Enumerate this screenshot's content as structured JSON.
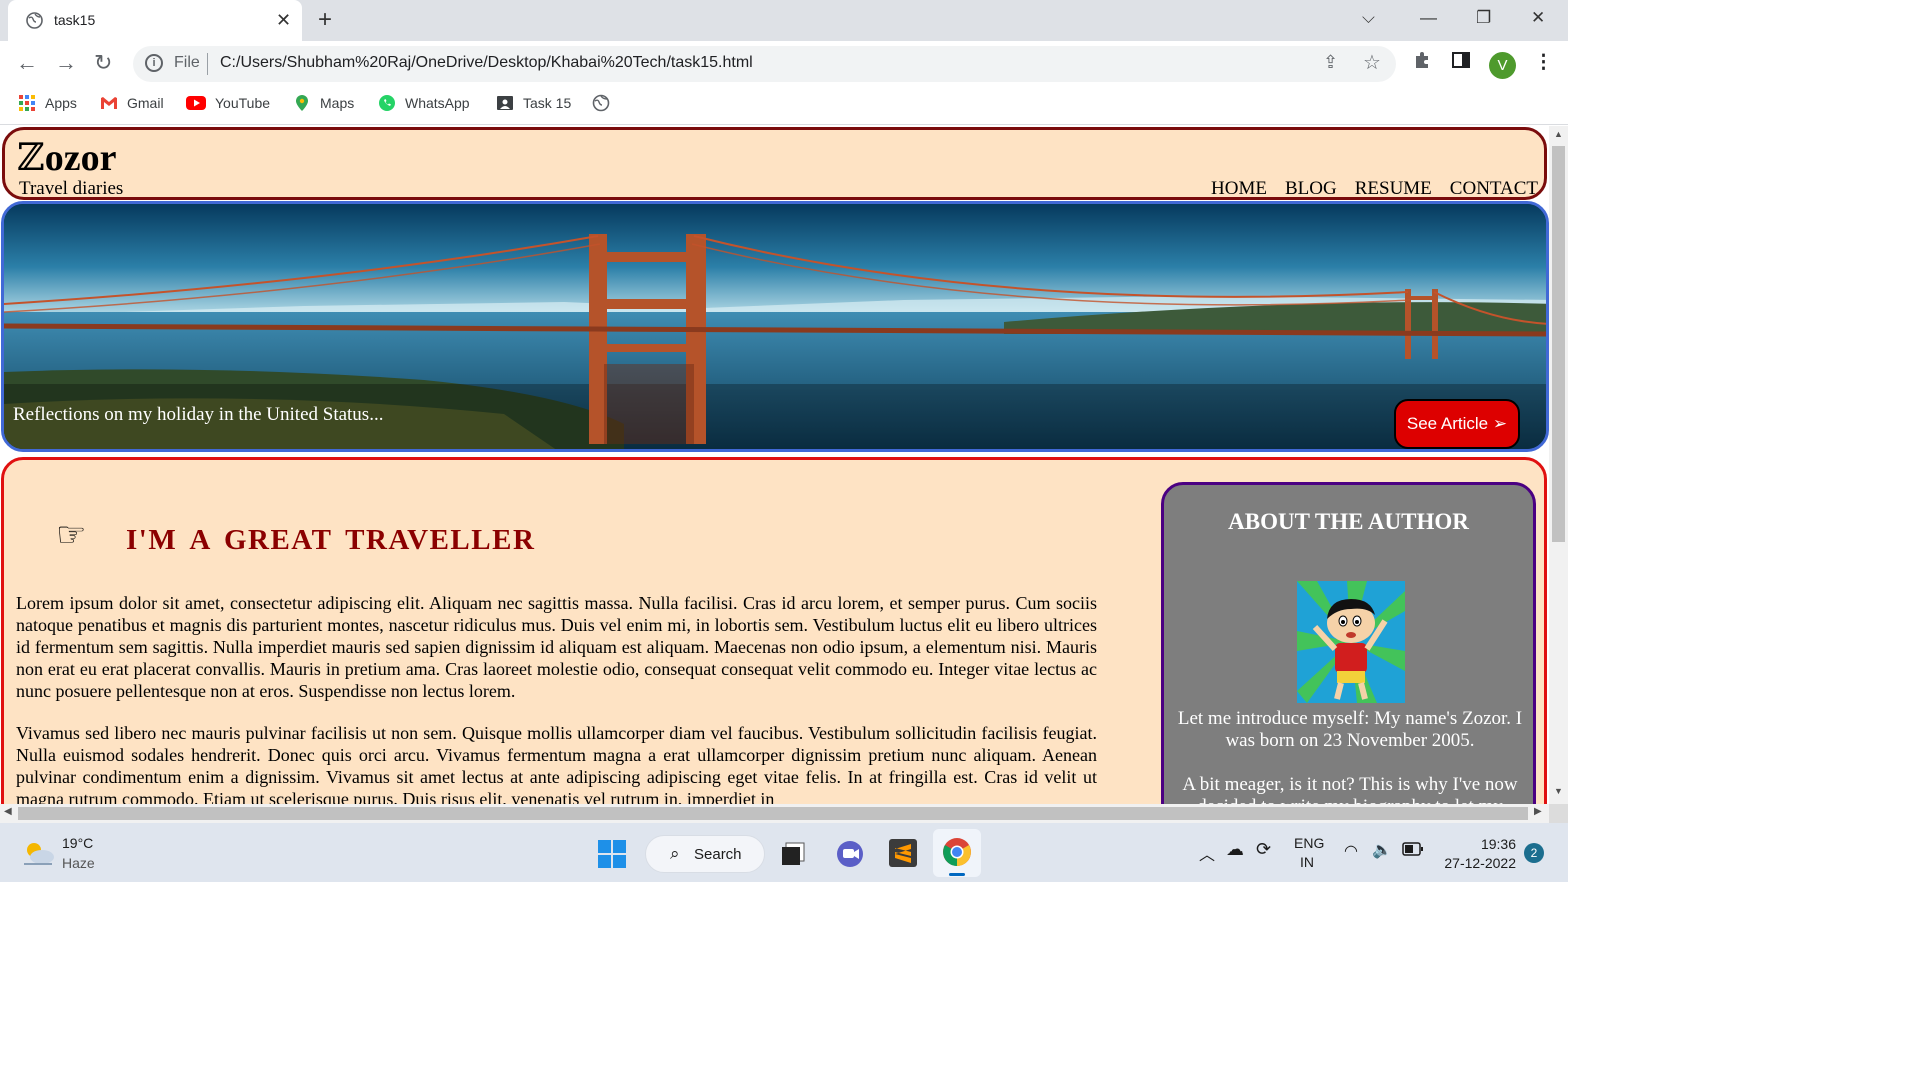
{
  "browser": {
    "tab_title": "task15",
    "address": {
      "scheme_label": "File",
      "url": "C:/Users/Shubham%20Raj/OneDrive/Desktop/Khabai%20Tech/task15.html"
    },
    "profile_initial": "V",
    "bookmarks": [
      "Apps",
      "Gmail",
      "YouTube",
      "Maps",
      "WhatsApp",
      "Task 15"
    ]
  },
  "site": {
    "logo_first": "ℤ",
    "logo_rest": "ozor",
    "tagline": "Travel diaries",
    "menu": [
      "HOME",
      "BLOG",
      "RESUME",
      "CONTACT"
    ],
    "hero": {
      "caption": "Reflections on my holiday in the United Status...",
      "button": "See Article ➢"
    },
    "article": {
      "pointer_glyph": "☞",
      "heading": "I'M A GREAT TRAVELLER",
      "paragraphs": [
        "Lorem ipsum dolor sit amet, consectetur adipiscing elit. Aliquam nec sagittis massa. Nulla facilisi. Cras id arcu lorem, et semper purus. Cum sociis natoque penatibus et magnis dis parturient montes, nascetur ridiculus mus. Duis vel enim mi, in lobortis sem. Vestibulum luctus elit eu libero ultrices id fermentum sem sagittis. Nulla imperdiet mauris sed sapien dignissim id aliquam est aliquam. Maecenas non odio ipsum, a elementum nisi. Mauris non erat eu erat placerat convallis. Mauris in pretium ama. Cras laoreet molestie odio, consequat consequat velit commodo eu. Integer vitae lectus ac nunc posuere pellentesque non at eros. Suspendisse non lectus lorem.",
        "Vivamus sed libero nec mauris pulvinar facilisis ut non sem. Quisque mollis ullamcorper diam vel faucibus. Vestibulum sollicitudin facilisis feugiat. Nulla euismod sodales hendrerit. Donec quis orci arcu. Vivamus fermentum magna a erat ullamcorper dignissim pretium nunc aliquam. Aenean pulvinar condimentum enim a dignissim. Vivamus sit amet lectus at ante adipiscing adipiscing eget vitae felis. In at fringilla est. Cras id velit ut magna rutrum commodo. Etiam ut scelerisque purus. Duis risus elit, venenatis vel rutrum in, imperdiet in"
      ]
    },
    "about": {
      "title": "ABOUT THE AUTHOR",
      "intro": "Let me introduce myself: My name's Zozor. I was born on 23 November 2005.",
      "more": "A bit meager, is it not? This is why I've now decided to write my biography to let my readers know who I really am."
    }
  },
  "taskbar": {
    "weather_temp": "19°C",
    "weather_condition": "Haze",
    "search_label": "Search",
    "lang_top": "ENG",
    "lang_bottom": "IN",
    "time": "19:36",
    "date": "27-12-2022",
    "notification_count": "2"
  },
  "colors": {
    "header_border": "#7a0c0c",
    "page_background": "#fee3c4",
    "hero_border": "#4169d6",
    "content_border": "#e01010",
    "heading": "#8b0000",
    "button": "#dd0000",
    "about_border": "#4b0082",
    "about_background": "#7e7e7e"
  }
}
